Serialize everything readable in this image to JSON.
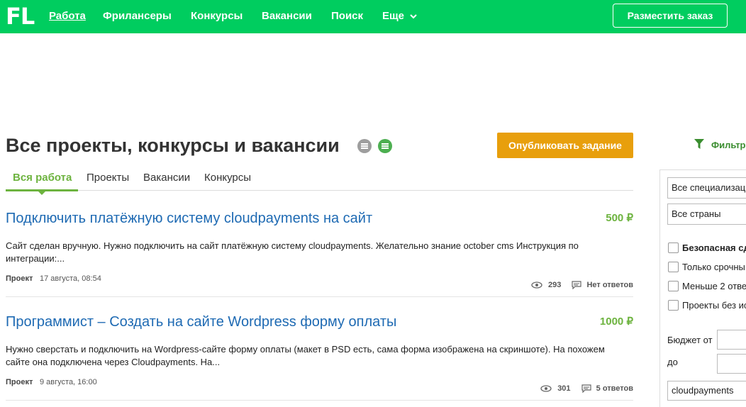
{
  "header": {
    "logo": "FL",
    "nav": [
      {
        "label": "Работа",
        "active": true
      },
      {
        "label": "Фрилансеры"
      },
      {
        "label": "Конкурсы"
      },
      {
        "label": "Вакансии"
      },
      {
        "label": "Поиск"
      },
      {
        "label": "Еще"
      }
    ],
    "order_button": "Разместить заказ",
    "bg_color": "#00cd5f"
  },
  "page": {
    "title": "Все проекты, конкурсы и вакансии",
    "publish_button": "Опубликовать задание",
    "tabs": [
      "Вся работа",
      "Проекты",
      "Вакансии",
      "Конкурсы"
    ],
    "active_tab": "Вся работа"
  },
  "projects": [
    {
      "title": "Подключить платёжную систему cloudpayments на сайт",
      "price": "500 ₽",
      "description": "Сайт сделан вручную. Нужно подключить на сайт платёжную систему cloudpayments. Желательно знание october cms Инструкция по интеграции:...",
      "type": "Проект",
      "date": "17 августа, 08:54",
      "views": "293",
      "answers": "Нет ответов"
    },
    {
      "title": "Программист – Создать на сайте Wordpress форму оплаты",
      "price": "1000 ₽",
      "description": "Нужно сверстать и подключить на Wordpress-сайте форму оплаты (макет в PSD есть, сама форма изображена на скриншоте). На похожем сайте она подключена через Cloudpayments. На...",
      "type": "Проект",
      "date": "9 августа, 16:00",
      "views": "301",
      "answers": "5 ответов"
    }
  ],
  "filters": {
    "label": "Фильтр",
    "specialization": "Все специализац",
    "countries": "Все страны",
    "checkboxes": [
      "Безопасная сд",
      "Только срочны",
      "Меньше 2 отве",
      "Проекты без ис"
    ],
    "budget_from": "Бюджет от",
    "budget_to": "до",
    "keyword": "cloudpayments"
  }
}
